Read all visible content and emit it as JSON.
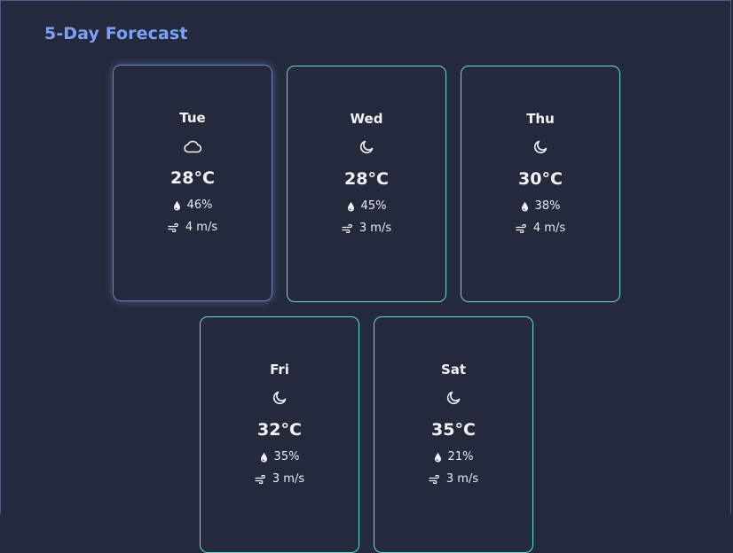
{
  "page": {
    "title": "5-Day Forecast"
  },
  "days": [
    {
      "day": "Tue",
      "temp": "28°C",
      "humidity": "46%",
      "wind": "4 m/s",
      "icon": "cloud-icon"
    },
    {
      "day": "Wed",
      "temp": "28°C",
      "humidity": "45%",
      "wind": "3 m/s",
      "icon": "moon-icon"
    },
    {
      "day": "Thu",
      "temp": "30°C",
      "humidity": "38%",
      "wind": "4 m/s",
      "icon": "moon-icon"
    },
    {
      "day": "Fri",
      "temp": "32°C",
      "humidity": "35%",
      "wind": "3 m/s",
      "icon": "moon-icon"
    },
    {
      "day": "Sat",
      "temp": "35°C",
      "humidity": "21%",
      "wind": "3 m/s",
      "icon": "moon-icon"
    }
  ],
  "colors": {
    "background": "#24293b",
    "accent": "#7aa2f7",
    "card_border": "#5fe3c6",
    "card_border_active": "#6a7fbf"
  }
}
